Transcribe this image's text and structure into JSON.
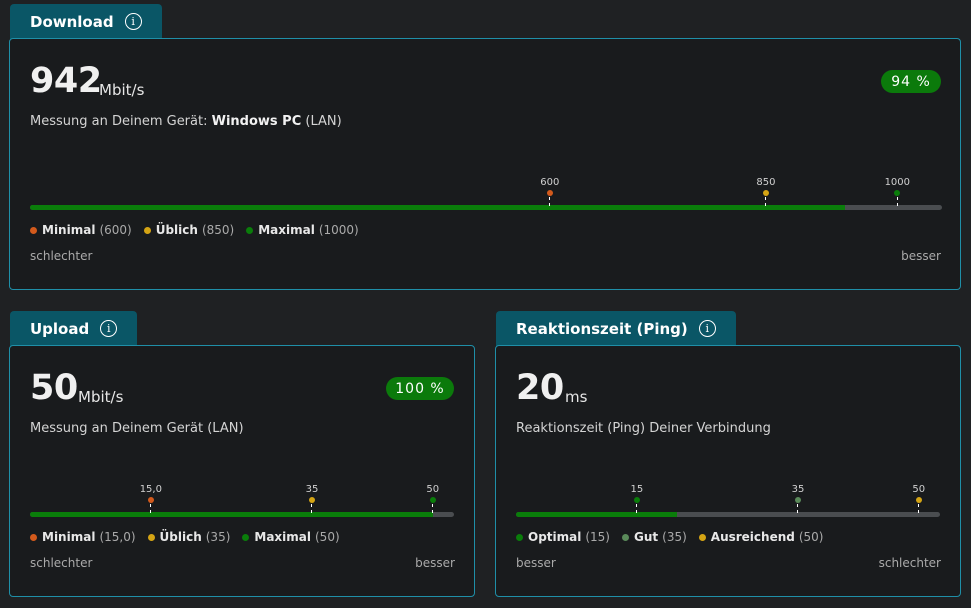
{
  "colors": {
    "red": "#d35a1c",
    "yellow": "#d4a414",
    "green": "#0a7d0a",
    "greyGreen": "#5a8a5a",
    "badge": "#0b7a0b"
  },
  "download": {
    "tab_title": "Download",
    "value": "942",
    "unit": "Mbit/s",
    "desc_prefix": "Messung an Deinem Gerät: ",
    "device": "Windows PC",
    "connection": " (LAN)",
    "percent": "94 %",
    "fill_fraction": 0.894,
    "markers": [
      {
        "label": "600",
        "fraction": 0.57,
        "color": "#d35a1c"
      },
      {
        "label": "850",
        "fraction": 0.807,
        "color": "#d4a414"
      },
      {
        "label": "1000",
        "fraction": 0.951,
        "color": "#0a7d0a"
      }
    ],
    "legend": [
      {
        "name": "Minimal",
        "value": "(600)",
        "color": "#d35a1c"
      },
      {
        "name": "Üblich",
        "value": "(850)",
        "color": "#d4a414"
      },
      {
        "name": "Maximal",
        "value": "(1000)",
        "color": "#0a7d0a"
      }
    ],
    "left_label": "schlechter",
    "right_label": "besser"
  },
  "upload": {
    "tab_title": "Upload",
    "value": "50",
    "unit": "Mbit/s",
    "desc": "Messung an Deinem Gerät (LAN)",
    "percent": "100 %",
    "fill_fraction": 0.95,
    "markers": [
      {
        "label": "15,0",
        "fraction": 0.285,
        "color": "#d35a1c"
      },
      {
        "label": "35",
        "fraction": 0.665,
        "color": "#d4a414"
      },
      {
        "label": "50",
        "fraction": 0.95,
        "color": "#0a7d0a"
      }
    ],
    "legend": [
      {
        "name": "Minimal",
        "value": "(15,0)",
        "color": "#d35a1c"
      },
      {
        "name": "Üblich",
        "value": "(35)",
        "color": "#d4a414"
      },
      {
        "name": "Maximal",
        "value": "(50)",
        "color": "#0a7d0a"
      }
    ],
    "left_label": "schlechter",
    "right_label": "besser"
  },
  "ping": {
    "tab_title": "Reaktionszeit (Ping)",
    "value": "20",
    "unit": "ms",
    "desc": "Reaktionszeit (Ping) Deiner Verbindung",
    "fill_fraction": 0.38,
    "markers": [
      {
        "label": "15",
        "fraction": 0.285,
        "color": "#0a7d0a"
      },
      {
        "label": "35",
        "fraction": 0.665,
        "color": "#5a8a5a"
      },
      {
        "label": "50",
        "fraction": 0.95,
        "color": "#d4a414"
      }
    ],
    "legend": [
      {
        "name": "Optimal",
        "value": "(15)",
        "color": "#0a7d0a"
      },
      {
        "name": "Gut",
        "value": "(35)",
        "color": "#5a8a5a"
      },
      {
        "name": "Ausreichend",
        "value": "(50)",
        "color": "#d4a414"
      }
    ],
    "left_label": "besser",
    "right_label": "schlechter"
  }
}
